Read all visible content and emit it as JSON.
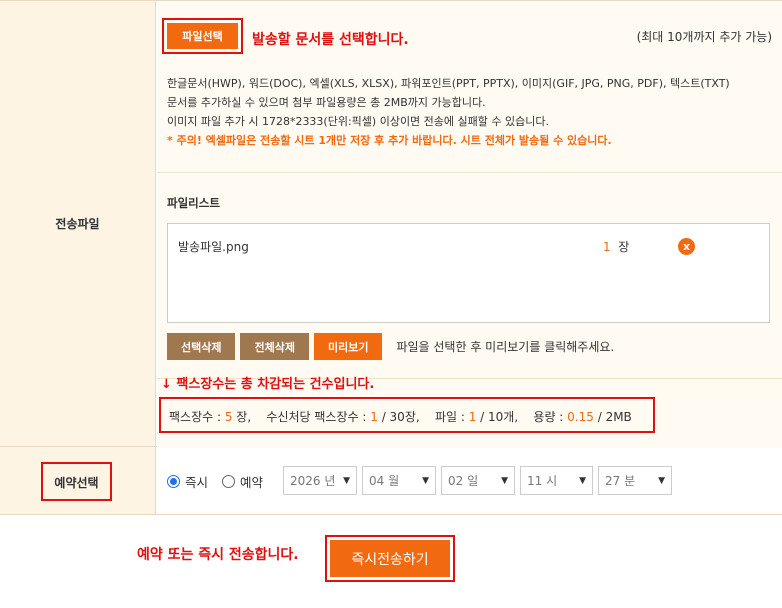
{
  "file_section": {
    "label": "전송파일",
    "select_button": "파일선택",
    "select_hint": "발송할 문서를 선택합니다.",
    "max_note": "(최대 10개까지 추가 가능)",
    "desc_line1": "한글문서(HWP), 워드(DOC), 엑셀(XLS, XLSX), 파워포인트(PPT, PPTX), 이미지(GIF, JPG, PNG, PDF), 텍스트(TXT)",
    "desc_line2": "문서를 추가하실 수 있으며 첨부 파일용량은 총 2MB까지 가능합니다.",
    "desc_line3": "이미지 파일 추가 시 1728*2333(단위:픽셀) 이상이면 전송에 실패할 수 있습니다.",
    "desc_warn": "* 주의! 엑셀파일은 전송할 시트 1개만 저장 후 추가 바랍니다. 시트 전체가 발송될 수 있습니다.",
    "list_title": "파일리스트",
    "files": [
      {
        "name": "발송파일.png",
        "count": "1",
        "unit": "장",
        "remove_icon": "x"
      }
    ],
    "btn_delete_selected": "선택삭제",
    "btn_delete_all": "전체삭제",
    "btn_preview": "미리보기",
    "action_note": "파일을 선택한 후 미리보기를 클릭해주세요.",
    "summary_hint": "↓ 팩스장수는 총 차감되는 건수입니다.",
    "summary": {
      "fax_pages_label": "팩스장수 : ",
      "fax_pages": "5",
      "fax_pages_unit": " 장,",
      "per_recipient_label": "수신처당 팩스장수 : ",
      "per_recipient": "1",
      "per_recipient_unit": " / 30장,",
      "file_label": "파일 : ",
      "file_count": "1",
      "file_unit": " / 10개,",
      "size_label": "용량 : ",
      "size": "0.15",
      "size_unit": " / 2MB"
    }
  },
  "reserve_section": {
    "label": "예약선택",
    "opt_now": "즉시",
    "opt_reserve": "예약",
    "selected": "즉시",
    "year": "2026 년",
    "month": "04 월",
    "day": "02 일",
    "hour": "11 시",
    "minute": "27 분"
  },
  "submit_section": {
    "hint": "예약 또는 즉시 전송합니다.",
    "button": "즉시전송하기"
  },
  "colors": {
    "accent": "#f26a10",
    "highlight_red": "#e01010",
    "label_bg": "#fdf4e4",
    "brown_button": "#a07850"
  }
}
